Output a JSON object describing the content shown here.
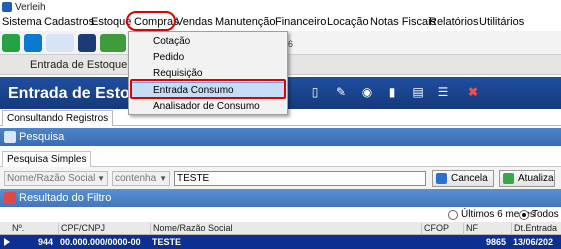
{
  "window": {
    "title": "Verleih"
  },
  "menubar": {
    "items": [
      "Sistema",
      "Cadastros",
      "Estoque",
      "Compras",
      "Vendas",
      "Manutenção",
      "Financeiro",
      "Locação",
      "Notas Fiscais",
      "Relatórios",
      "Utilitários"
    ],
    "active": "Compras"
  },
  "toolbar": {
    "partial_text": "6"
  },
  "entrada_strip": {
    "label": "Entrada de Estoque Co"
  },
  "header": {
    "title": "Entrada de Estoque"
  },
  "tabs": {
    "consultando": "Consultando Registros"
  },
  "pesquisa": {
    "title": "Pesquisa",
    "subtab": "Pesquisa Simples",
    "field_combo": "Nome/Razão Social",
    "operator_combo": "contenha",
    "search_value": "TESTE",
    "cancel_label": "Cancela",
    "refresh_label": "Atualiza"
  },
  "resultado": {
    "title": "Resultado do Filtro",
    "radio_last": "Últimos 6 meses",
    "radio_all": "Todos",
    "selected_radio": "Todos"
  },
  "grid": {
    "columns": [
      "Nº.",
      "CPF/CNPJ",
      "Nome/Razão Social",
      "CFOP",
      "NF",
      "Dt.Entrada"
    ],
    "rows": [
      {
        "num": "944",
        "cpf": "00.000.000/0000-00",
        "nome": "TESTE",
        "cfop": "",
        "nf": "9865",
        "dt": "13/06/202"
      }
    ]
  },
  "dropdown": {
    "items": [
      "Cotação",
      "Pedido",
      "Requisição",
      "Entrada Consumo",
      "Analisador de Consumo"
    ],
    "highlighted": "Entrada Consumo"
  },
  "colors": {
    "header_blue": "#1f4fa0",
    "selected_row": "#0c2f91",
    "annotation_red": "#e00000",
    "menu_hover": "#c7ddf6"
  }
}
